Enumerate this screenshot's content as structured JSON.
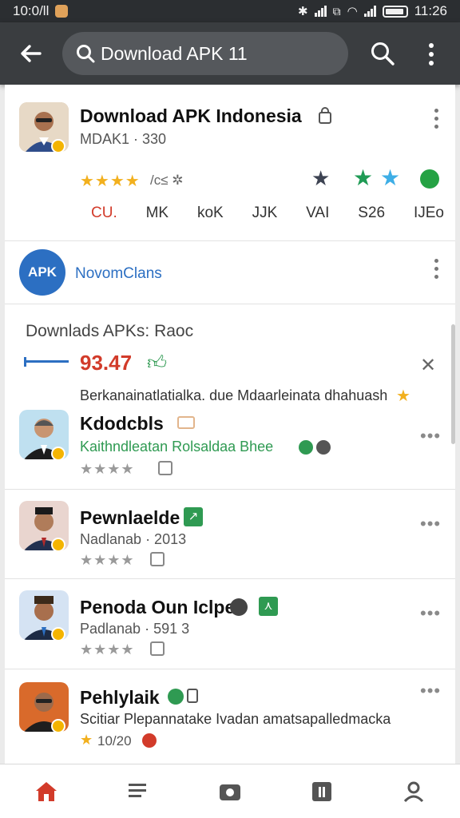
{
  "status_bar": {
    "time_left": "10:0/ll",
    "time_right": "11:26"
  },
  "search": {
    "query": "Download APK 11"
  },
  "top_item": {
    "title": "Download APK Indonesia",
    "subtitle": "MDAK1 · 330",
    "rating_text": "/c≤ ✲",
    "tabs": [
      "CU.",
      "MK",
      "koK",
      "JJK",
      "VAI",
      "S26",
      "IJEo"
    ]
  },
  "brand_row": {
    "logo_text": "APK",
    "name": "NovomClans"
  },
  "downloads": {
    "heading": "Downlads APKs: Raoc",
    "value": "93.47",
    "description": "Berkanainatlatialka. due Mdaarleinata dhahuash"
  },
  "list": [
    {
      "title": "Kdodcbls",
      "subtitle": "Kaithndleatan Rolsaldaa Bhee",
      "subtitle_color": "#2f9a52"
    },
    {
      "title": "Pewnlaelde",
      "subtitle": "Nadlanab · 2013",
      "subtitle_color": "#555555"
    },
    {
      "title": "Penoda Oun Iclpe",
      "subtitle": "Padlanab · 591 3",
      "subtitle_color": "#555555"
    },
    {
      "title": "Pehlylaik",
      "subtitle": "Scitiar Plepannatake Ivadan amatsapalledmacka",
      "subtitle_color": "#555555",
      "rating_text": "10/20"
    }
  ],
  "colors": {
    "accent_red": "#d23b2a",
    "accent_blue": "#2c6fc2",
    "green": "#2f9a52",
    "gold": "#f2b01e"
  }
}
